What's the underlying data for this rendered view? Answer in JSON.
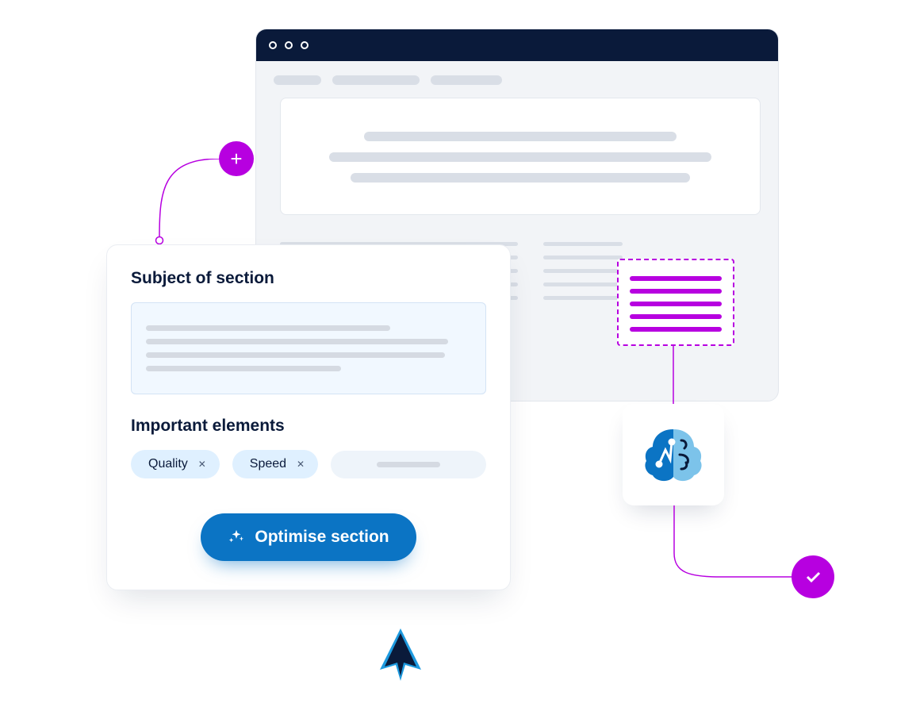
{
  "panel": {
    "subject_heading": "Subject of section",
    "elements_heading": "Important elements",
    "tags": [
      "Quality",
      "Speed"
    ],
    "cta_label": "Optimise section"
  },
  "colors": {
    "accent_purple": "#b700e0",
    "brand_blue": "#0b74c4",
    "navy": "#0a1a3a"
  },
  "icons": {
    "add": "plus-icon",
    "done": "check-icon",
    "ai": "brain-icon",
    "cta": "sparkle-icon",
    "cursor": "cursor-icon",
    "tag_remove": "x-icon"
  }
}
